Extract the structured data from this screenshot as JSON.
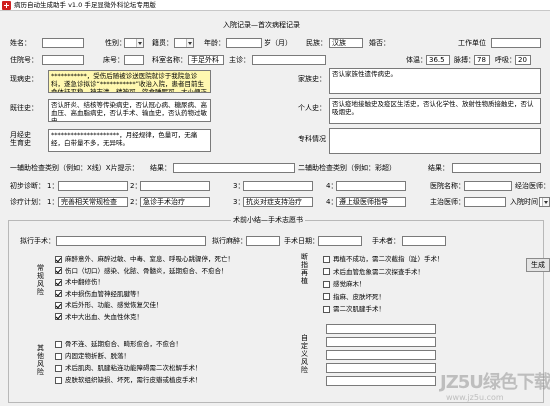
{
  "window": {
    "title": "病历自动生成助手 v1.0  手足显微外科论坛专用版"
  },
  "section": {
    "title": "入院记录—首次病程记录"
  },
  "row1": {
    "name": "姓名：",
    "sex": "性别：",
    "ethnic": "籍贯：",
    "age": "年龄：",
    "age_unit": "岁（月）",
    "nation": "民族：",
    "nation_value": "汉族",
    "marriage": "婚否：",
    "work": "工作单位"
  },
  "row2": {
    "admission_no": "住院号：",
    "bed": "床号：",
    "dept": "科室名称：",
    "dept_value": "手足外科",
    "director": "主诊：",
    "temp_label": "体温：",
    "temp": "36.5",
    "pulse_label": "脉搏：",
    "pulse": "78",
    "resp_label": "呼吸：",
    "resp": "20"
  },
  "history": {
    "present_label": "现病史：",
    "present_text": "***********，受伤后随被诊送医院就诊于我院急诊科，遂急诊拟诊“***********”收治入院，患者目前生命体征平稳，神志清，精神可，饮食睡眠可，大小便正常，体重无明显变化。",
    "family_label": "家族史：",
    "family_text": "否认家族性遗传病史。",
    "past_label": "既往史：",
    "past_text": "否认肝炎、结核等传染病史，否认冠心病、糖尿病、高血压、高血脂病史，否认手术、输血史，否认药物过敏史。",
    "personal_label": "个人史：",
    "personal_text": "否认疫地接触史及疫区生活史，否认化学性、放射性物质接触史，否认吸烟史。",
    "menstrual_label": "月经史\n生育史",
    "menstrual_text": "*********************，月经规律，色量可，无痛经，白带量不多，无异味。",
    "special_label": "专科情况"
  },
  "aux": {
    "label1": "一辅助检查类别（例如：X线）X片提示：",
    "result1": "结果：",
    "label2": "二辅助检查类别（例如：彩超）",
    "result2": "结果："
  },
  "diagnosis": {
    "label": "初步诊断：",
    "n1": "1：",
    "n2": "2：",
    "n3": "3：",
    "n4": "4：",
    "hospital_label": "医院名称：",
    "doctor_label": "经治医师："
  },
  "plan": {
    "label": "诊疗计划：",
    "n1": "1：",
    "v1": "完善相关常规检查",
    "n2": "2：",
    "v2": "急诊手术治疗",
    "n3": "3：",
    "v3": "抗炎对症支持治疗",
    "n4": "4：",
    "v4": "遵上级医师指导",
    "chief_label": "主治医师：",
    "date_label": "入院时间："
  },
  "preop": {
    "group_title": "术前小结—手术志愿书",
    "surgery_label": "拟行手术：",
    "anesth_label": "拟行麻醉：",
    "date_label": "手术日期：",
    "operator_label": "手术者：",
    "risk_group": "常规风险",
    "risks": [
      {
        "text": "麻醉意外、麻醉过敏、中毒、窒息、呼吸心跳骤停，死亡！",
        "checked": true
      },
      {
        "text": "伤口（切口）感染、化脓、骨髓炎，延期愈合、不愈合！",
        "checked": true
      },
      {
        "text": "术中翻修伤！",
        "checked": true
      },
      {
        "text": "术中损伤血管神经肌腱等！",
        "checked": true
      },
      {
        "text": "术后外形、功能、感觉恢复欠佳！",
        "checked": true
      },
      {
        "text": "术中大出血、失血性休克！",
        "checked": true
      }
    ],
    "other_group": "其他风险",
    "others": [
      {
        "text": "骨不连、延期愈合、畸形愈合，不愈合！",
        "checked": false
      },
      {
        "text": "内固定物折断、脱落！",
        "checked": false
      },
      {
        "text": "术后肌肉、肌腱粘连功能障碍需二次松解手术！",
        "checked": false
      },
      {
        "text": "皮肤软组织缺损、坏死，需行皮瓣或植皮手术！",
        "checked": false
      }
    ],
    "limb_group": "断指再植",
    "limbs": [
      {
        "text": "再植不成功，需二次截指（趾）手术！",
        "checked": false
      },
      {
        "text": "术后血管危象需二次探查手术！",
        "checked": false
      },
      {
        "text": "感觉麻木！",
        "checked": false
      },
      {
        "text": "指麻、皮肤坏死！",
        "checked": false
      },
      {
        "text": "需二次肌腱手术！",
        "checked": false
      }
    ],
    "custom_group": "自定义风险"
  },
  "buttons": {
    "generate": "生成"
  },
  "watermark": {
    "big": "JZ5U绿色下载",
    "small": "www.jz5u.com"
  }
}
